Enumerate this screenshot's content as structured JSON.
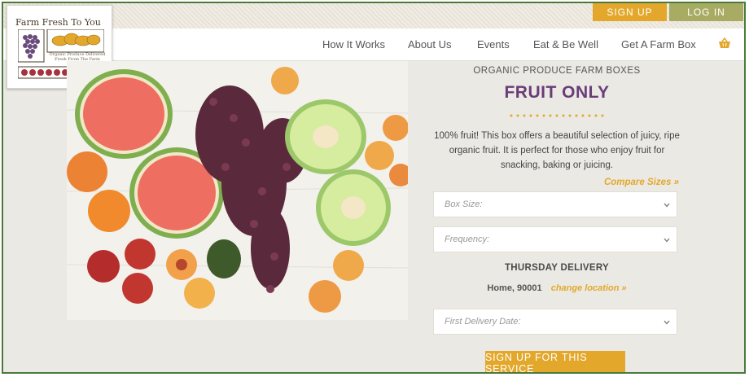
{
  "header": {
    "signup_label": "SIGN UP",
    "login_label": "LOG IN"
  },
  "logo": {
    "title": "Farm Fresh To You",
    "tagline": "Organic Produce Delivered Fresh From The Farm"
  },
  "nav": {
    "items": [
      "How It Works",
      "About Us",
      "Events",
      "Eat & Be Well",
      "Get A Farm Box"
    ],
    "cart_icon": "basket-icon"
  },
  "product": {
    "subtitle": "ORGANIC PRODUCE FARM BOXES",
    "title": "FRUIT ONLY",
    "description": "100% fruit! This box offers a beautiful selection of juicy, ripe organic fruit. It is perfect for those who enjoy fruit for snacking, baking or juicing.",
    "compare_link": "Compare Sizes »"
  },
  "form": {
    "box_size_placeholder": "Box Size:",
    "frequency_placeholder": "Frequency:",
    "delivery_heading": "THURSDAY DELIVERY",
    "location": "Home, 90001",
    "change_location": "change location »",
    "first_delivery_placeholder": "First Delivery Date:",
    "submit_label": "SIGN UP FOR THIS SERVICE"
  },
  "colors": {
    "accent_orange": "#e3a82b",
    "accent_olive": "#a8ac63",
    "title_purple": "#6a3c78",
    "frame_green": "#4a7a3a"
  }
}
